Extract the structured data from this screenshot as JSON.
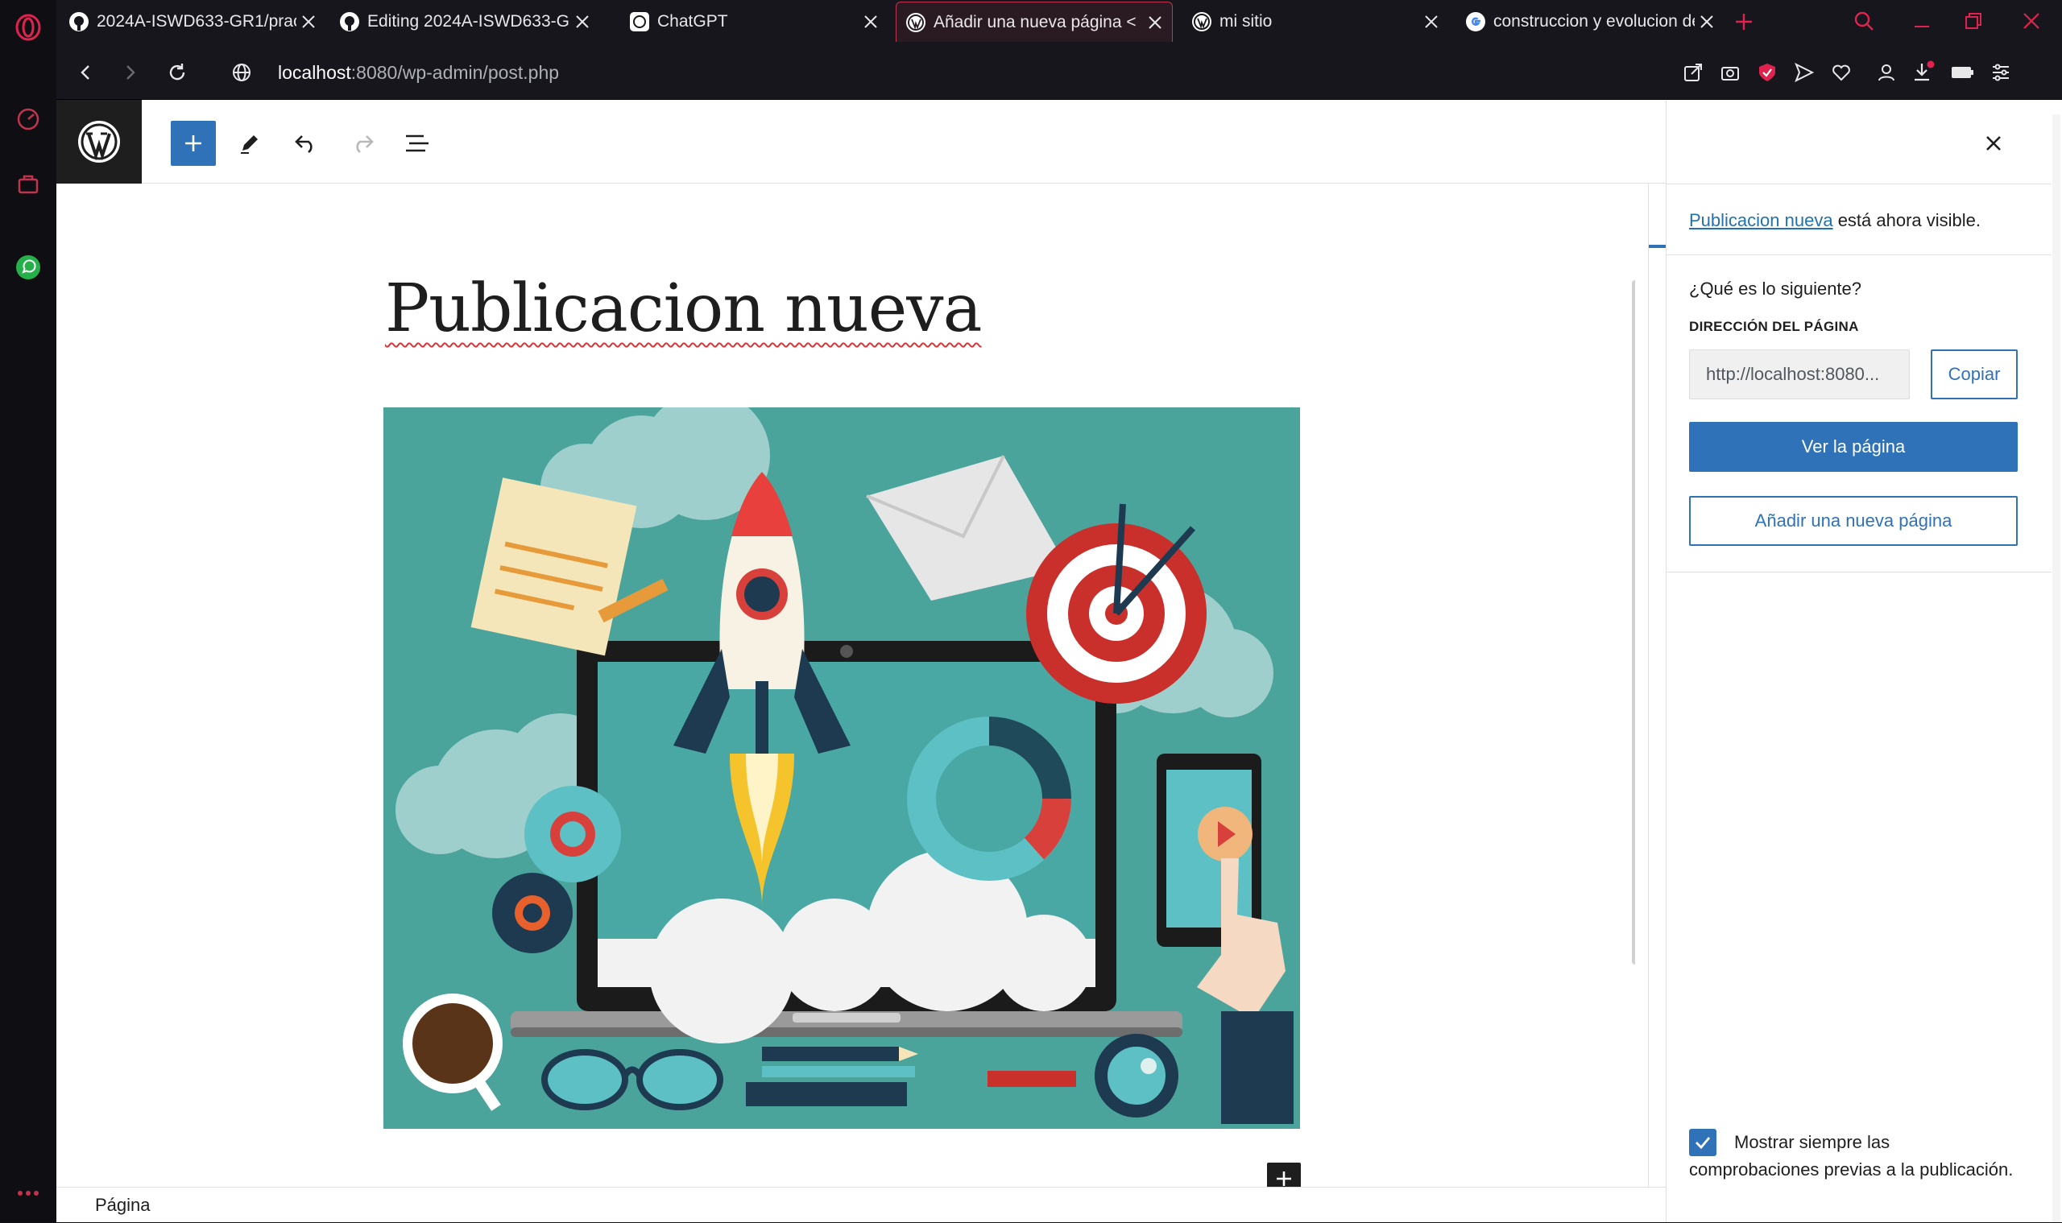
{
  "browser": {
    "tabs": [
      {
        "title": "2024A-ISWD633-GR1/practica",
        "icon": "github-icon",
        "active": false
      },
      {
        "title": "Editing 2024A-ISWD633-GR1",
        "icon": "github-icon",
        "active": false
      },
      {
        "title": "ChatGPT",
        "icon": "chatgpt-icon",
        "active": false
      },
      {
        "title": "Añadir una nueva página <",
        "icon": "wordpress-icon",
        "active": true
      },
      {
        "title": "mi sitio",
        "icon": "wordpress-icon",
        "active": false
      },
      {
        "title": "construccion y evolucion de",
        "icon": "google-icon",
        "active": false
      }
    ],
    "url_host": "localhost",
    "url_rest": ":8080/wp-admin/post.php",
    "accent": "#c2344e"
  },
  "editor": {
    "post_title": "Publicacion nueva",
    "footer_label": "Página"
  },
  "panel": {
    "notice_link": "Publicacion nueva",
    "notice_rest": " está ahora visible.",
    "next_heading": "¿Qué es lo siguiente?",
    "address_label": "DIRECCIÓN DEL PÁGINA",
    "address_value": "http://localhost:8080...",
    "copy_label": "Copiar",
    "view_label": "Ver la página",
    "add_new_label": "Añadir una nueva página",
    "checkbox_label": "Mostrar siempre las comprobaciones previas a la publicación.",
    "checkbox_checked": true,
    "primary_color": "#2f72b8"
  }
}
